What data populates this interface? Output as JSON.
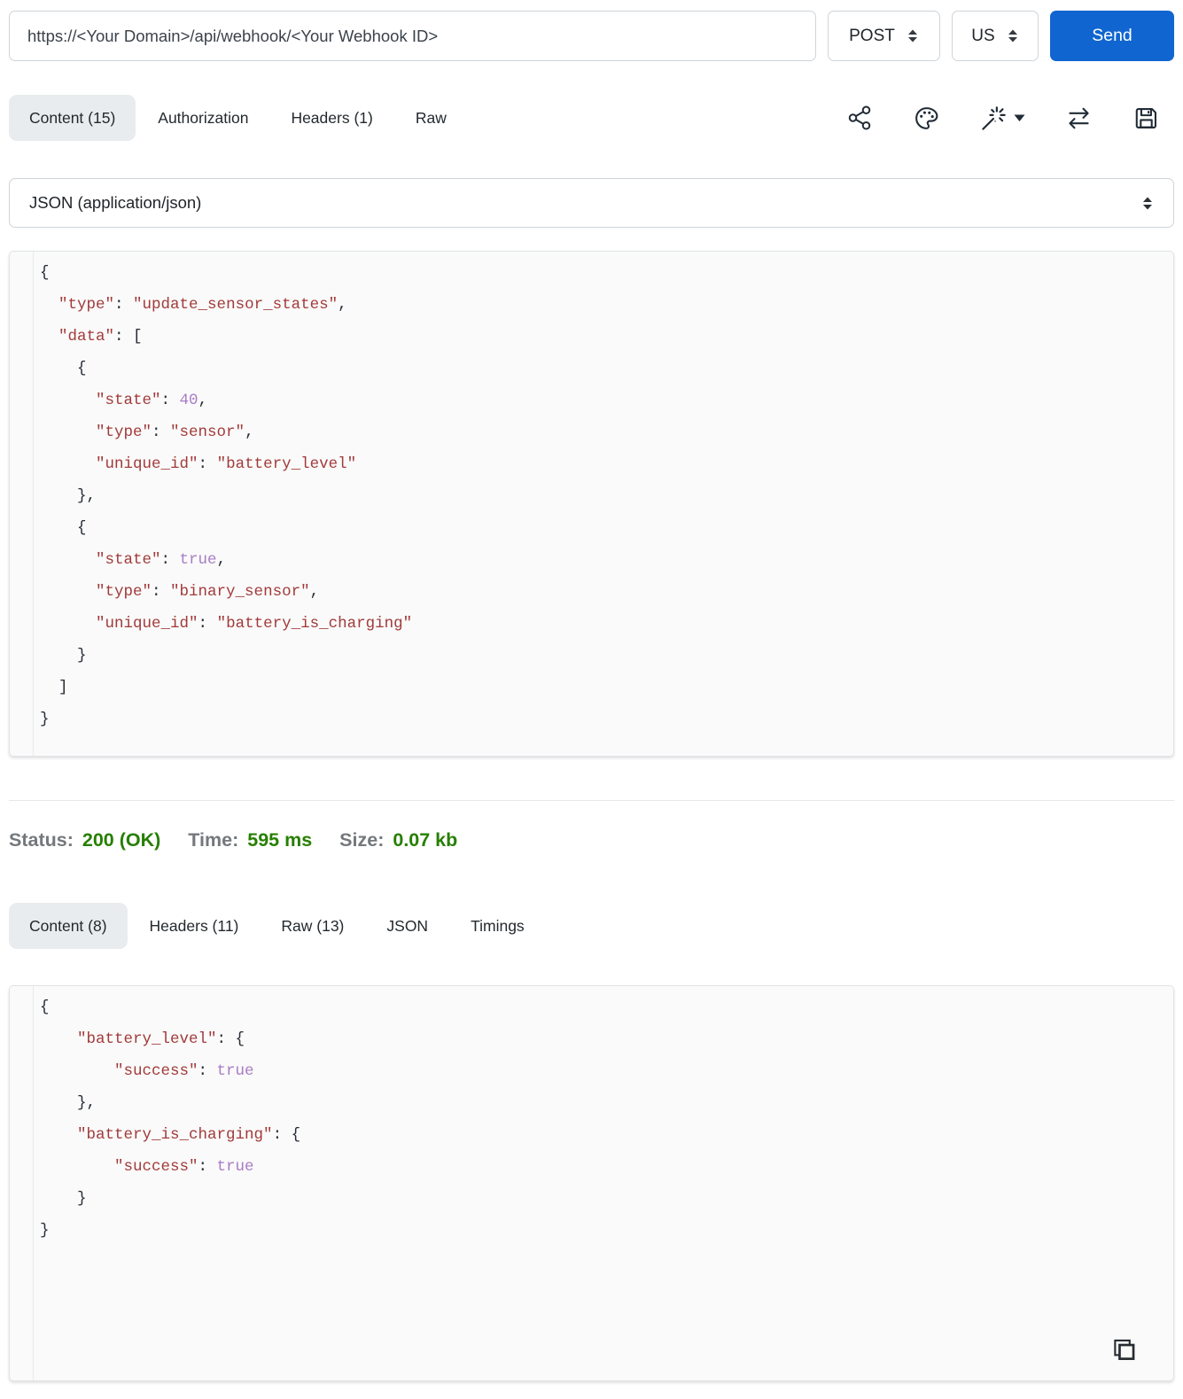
{
  "request_bar": {
    "url": "https://<Your Domain>/api/webhook/<Your Webhook ID>",
    "method": "POST",
    "locale": "US",
    "send_label": "Send"
  },
  "request_tabs": [
    {
      "label": "Content (15)",
      "active": true
    },
    {
      "label": "Authorization",
      "active": false
    },
    {
      "label": "Headers (1)",
      "active": false
    },
    {
      "label": "Raw",
      "active": false
    }
  ],
  "toolbar_icons": [
    {
      "name": "share-icon"
    },
    {
      "name": "palette-icon"
    },
    {
      "name": "magic-wand-icon",
      "has_caret": true
    },
    {
      "name": "swap-arrows-icon"
    },
    {
      "name": "save-icon"
    }
  ],
  "body_type_select": {
    "value": "JSON (application/json)"
  },
  "request_body_lines": [
    [
      {
        "c": "p",
        "t": "{"
      }
    ],
    [
      {
        "c": "p",
        "t": "  "
      },
      {
        "c": "s",
        "t": "\"type\""
      },
      {
        "c": "p",
        "t": ": "
      },
      {
        "c": "s",
        "t": "\"update_sensor_states\""
      },
      {
        "c": "p",
        "t": ","
      }
    ],
    [
      {
        "c": "p",
        "t": "  "
      },
      {
        "c": "s",
        "t": "\"data\""
      },
      {
        "c": "p",
        "t": ": ["
      }
    ],
    [
      {
        "c": "p",
        "t": "    {"
      }
    ],
    [
      {
        "c": "p",
        "t": "      "
      },
      {
        "c": "s",
        "t": "\"state\""
      },
      {
        "c": "p",
        "t": ": "
      },
      {
        "c": "v",
        "t": "40"
      },
      {
        "c": "p",
        "t": ","
      }
    ],
    [
      {
        "c": "p",
        "t": "      "
      },
      {
        "c": "s",
        "t": "\"type\""
      },
      {
        "c": "p",
        "t": ": "
      },
      {
        "c": "s",
        "t": "\"sensor\""
      },
      {
        "c": "p",
        "t": ","
      }
    ],
    [
      {
        "c": "p",
        "t": "      "
      },
      {
        "c": "s",
        "t": "\"unique_id\""
      },
      {
        "c": "p",
        "t": ": "
      },
      {
        "c": "s",
        "t": "\"battery_level\""
      }
    ],
    [
      {
        "c": "p",
        "t": "    },"
      }
    ],
    [
      {
        "c": "p",
        "t": "    {"
      }
    ],
    [
      {
        "c": "p",
        "t": "      "
      },
      {
        "c": "s",
        "t": "\"state\""
      },
      {
        "c": "p",
        "t": ": "
      },
      {
        "c": "v",
        "t": "true"
      },
      {
        "c": "p",
        "t": ","
      }
    ],
    [
      {
        "c": "p",
        "t": "      "
      },
      {
        "c": "s",
        "t": "\"type\""
      },
      {
        "c": "p",
        "t": ": "
      },
      {
        "c": "s",
        "t": "\"binary_sensor\""
      },
      {
        "c": "p",
        "t": ","
      }
    ],
    [
      {
        "c": "p",
        "t": "      "
      },
      {
        "c": "s",
        "t": "\"unique_id\""
      },
      {
        "c": "p",
        "t": ": "
      },
      {
        "c": "s",
        "t": "\"battery_is_charging\""
      }
    ],
    [
      {
        "c": "p",
        "t": "    }"
      }
    ],
    [
      {
        "c": "p",
        "t": "  ]"
      }
    ],
    [
      {
        "c": "p",
        "t": "}"
      }
    ]
  ],
  "status_bar": {
    "status_label": "Status:",
    "status_value": "200 (OK)",
    "time_label": "Time:",
    "time_value": "595 ms",
    "size_label": "Size:",
    "size_value": "0.07 kb"
  },
  "response_tabs": [
    {
      "label": "Content (8)",
      "active": true
    },
    {
      "label": "Headers (11)",
      "active": false
    },
    {
      "label": "Raw (13)",
      "active": false
    },
    {
      "label": "JSON",
      "active": false
    },
    {
      "label": "Timings",
      "active": false
    }
  ],
  "response_body_lines": [
    [
      {
        "c": "p",
        "t": "{"
      }
    ],
    [
      {
        "c": "p",
        "t": "    "
      },
      {
        "c": "s",
        "t": "\"battery_level\""
      },
      {
        "c": "p",
        "t": ": {"
      }
    ],
    [
      {
        "c": "p",
        "t": "        "
      },
      {
        "c": "s",
        "t": "\"success\""
      },
      {
        "c": "p",
        "t": ": "
      },
      {
        "c": "v",
        "t": "true"
      }
    ],
    [
      {
        "c": "p",
        "t": "    },"
      }
    ],
    [
      {
        "c": "p",
        "t": "    "
      },
      {
        "c": "s",
        "t": "\"battery_is_charging\""
      },
      {
        "c": "p",
        "t": ": {"
      }
    ],
    [
      {
        "c": "p",
        "t": "        "
      },
      {
        "c": "s",
        "t": "\"success\""
      },
      {
        "c": "p",
        "t": ": "
      },
      {
        "c": "v",
        "t": "true"
      }
    ],
    [
      {
        "c": "p",
        "t": "    }"
      }
    ],
    [
      {
        "c": "p",
        "t": "}"
      }
    ]
  ],
  "colors": {
    "accent_blue": "#1065d0",
    "status_green": "#267f00",
    "label_gray": "#74787c",
    "json_string": "#a23a3a",
    "json_value": "#a87cc5",
    "active_tab_bg": "#e9ecef"
  }
}
